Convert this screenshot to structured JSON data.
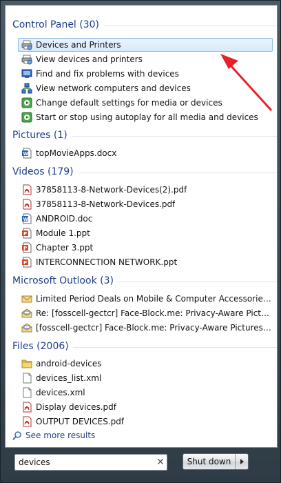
{
  "groups": [
    {
      "title": "Control Panel (30)",
      "items": [
        {
          "label": "Devices and Printers",
          "icon": "printer-icon",
          "selected": true
        },
        {
          "label": "View devices and printers",
          "icon": "printer-icon"
        },
        {
          "label": "Find and fix problems with devices",
          "icon": "troubleshoot-icon"
        },
        {
          "label": "View network computers and devices",
          "icon": "network-icon"
        },
        {
          "label": "Change default settings for media or devices",
          "icon": "autoplay-icon"
        },
        {
          "label": "Start or stop using autoplay for all media and devices",
          "icon": "autoplay-icon"
        }
      ]
    },
    {
      "title": "Pictures (1)",
      "items": [
        {
          "label": "topMovieApps.docx",
          "icon": "word-doc-icon"
        }
      ]
    },
    {
      "title": "Videos (179)",
      "items": [
        {
          "label": "37858113-8-Network-Devices(2).pdf",
          "icon": "pdf-icon"
        },
        {
          "label": "37858113-8-Network-Devices.pdf",
          "icon": "pdf-icon"
        },
        {
          "label": "ANDROID.doc",
          "icon": "word-doc-icon"
        },
        {
          "label": "Module 1.ppt",
          "icon": "ppt-icon"
        },
        {
          "label": "Chapter 3.ppt",
          "icon": "ppt-icon"
        },
        {
          "label": "INTERCONNECTION NETWORK.ppt",
          "icon": "ppt-icon"
        }
      ]
    },
    {
      "title": "Microsoft Outlook (3)",
      "items": [
        {
          "label": "Limited Period Deals on Mobile & Computer Accessories, Netw...",
          "icon": "mail-icon"
        },
        {
          "label": "Re: [fosscell-gectcr] Face-Block.me: Privacy-Aware Pictures for ...",
          "icon": "mail-read-icon"
        },
        {
          "label": "[fosscell-gectcr] Face-Block.me: Privacy-Aware Pictures for Mo...",
          "icon": "mail-read-icon"
        }
      ]
    },
    {
      "title": "Files (2006)",
      "items": [
        {
          "label": "android-devices",
          "icon": "folder-icon"
        },
        {
          "label": "devices_list.xml",
          "icon": "file-icon"
        },
        {
          "label": "devices.xml",
          "icon": "file-icon"
        },
        {
          "label": "Display devices.pdf",
          "icon": "pdf-icon"
        },
        {
          "label": "OUTPUT DEVICES.pdf",
          "icon": "pdf-icon"
        }
      ]
    }
  ],
  "see_more": "See more results",
  "search": {
    "value": "devices"
  },
  "shutdown_label": "Shut down",
  "colors": {
    "header": "#1e3d8a",
    "selection": "#d6eafc",
    "arrow": "#e8202a"
  }
}
